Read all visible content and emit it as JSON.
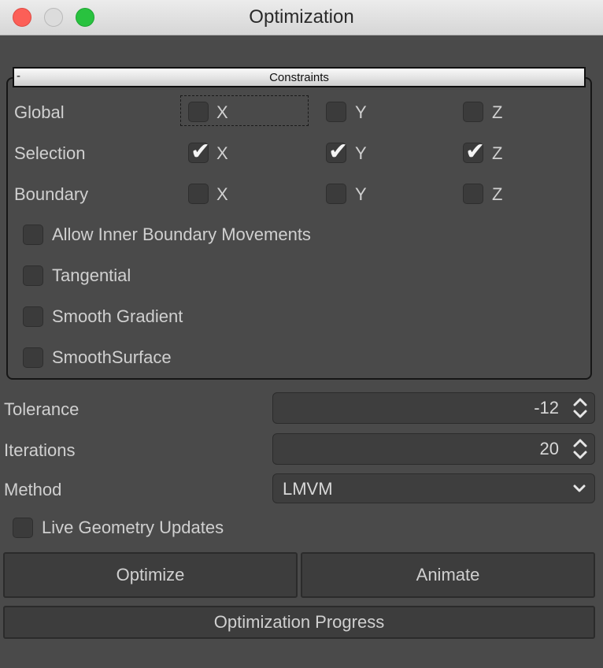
{
  "window": {
    "title": "Optimization"
  },
  "constraints": {
    "collapse_label": "-",
    "title": "Constraints",
    "axis_labels": [
      "X",
      "Y",
      "Z"
    ],
    "rows": [
      {
        "label": "Global",
        "x": false,
        "y": false,
        "z": false
      },
      {
        "label": "Selection",
        "x": true,
        "y": true,
        "z": true
      },
      {
        "label": "Boundary",
        "x": false,
        "y": false,
        "z": false
      }
    ],
    "options": [
      {
        "label": "Allow Inner Boundary Movements",
        "checked": false
      },
      {
        "label": "Tangential",
        "checked": false
      },
      {
        "label": "Smooth Gradient",
        "checked": false
      },
      {
        "label": "SmoothSurface",
        "checked": false
      }
    ]
  },
  "fields": {
    "tolerance": {
      "label": "Tolerance",
      "value": "-12"
    },
    "iterations": {
      "label": "Iterations",
      "value": "20"
    },
    "method": {
      "label": "Method",
      "value": "LMVM"
    }
  },
  "live_updates": {
    "label": "Live Geometry Updates",
    "checked": false
  },
  "buttons": {
    "optimize": "Optimize",
    "animate": "Animate",
    "progress": "Optimization Progress"
  }
}
